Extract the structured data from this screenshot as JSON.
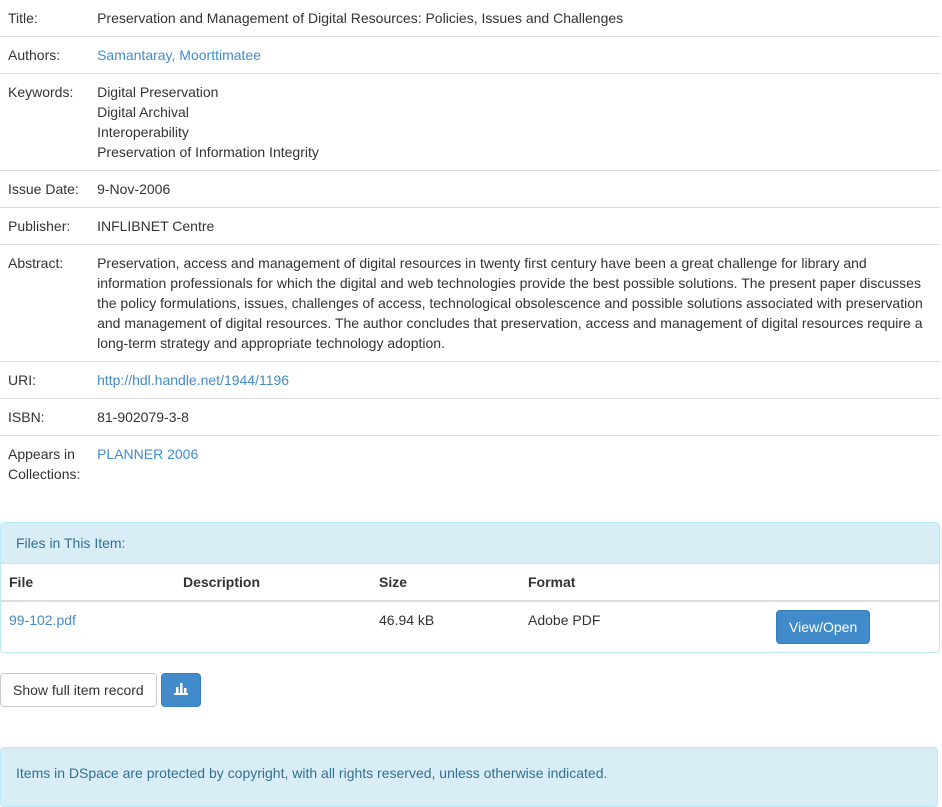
{
  "metadata": {
    "title_label": "Title:",
    "title_value": "Preservation and Management of Digital Resources: Policies, Issues and Challenges",
    "authors_label": "Authors:",
    "authors_value": "Samantaray, Moorttimatee",
    "keywords_label": "Keywords:",
    "keywords": [
      "Digital Preservation",
      "Digital Archival",
      "Interoperability",
      "Preservation of Information Integrity"
    ],
    "issue_date_label": "Issue Date:",
    "issue_date_value": "9-Nov-2006",
    "publisher_label": "Publisher:",
    "publisher_value": "INFLIBNET Centre",
    "abstract_label": "Abstract:",
    "abstract_value": "Preservation, access and management of digital resources in twenty first century have been a great challenge for library and information professionals for which the digital and web technologies provide the best possible solutions. The present paper discusses the policy formulations, issues, challenges of access, technological obsolescence and possible solutions associated with preservation and management of digital resources. The author concludes that preservation, access and management of digital resources require a long-term strategy and appropriate technology adoption.",
    "uri_label": "URI:",
    "uri_value": "http://hdl.handle.net/1944/1196",
    "isbn_label": "ISBN:",
    "isbn_value": "81-902079-3-8",
    "collections_label": "Appears in Collections:",
    "collections_value": "PLANNER 2006"
  },
  "files_panel": {
    "heading": "Files in This Item:",
    "columns": {
      "file": "File",
      "description": "Description",
      "size": "Size",
      "format": "Format"
    },
    "rows": [
      {
        "file": "99-102.pdf",
        "description": "",
        "size": "46.94 kB",
        "format": "Adobe PDF",
        "action": "View/Open"
      }
    ]
  },
  "actions": {
    "full_record_label": "Show full item record",
    "stats_icon": "bar-chart-icon"
  },
  "footer": {
    "notice": "Items in DSpace are protected by copyright, with all rights reserved, unless otherwise indicated."
  },
  "colors": {
    "link": "#428bca",
    "info_bg": "#d9edf7",
    "info_text": "#31708f",
    "primary": "#428bca"
  }
}
